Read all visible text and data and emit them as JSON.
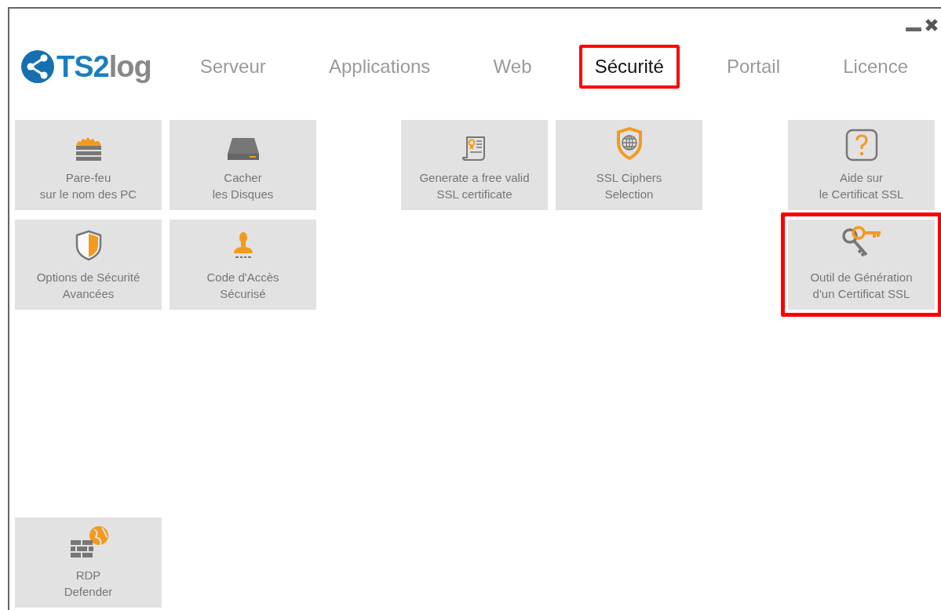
{
  "app": {
    "logo_prefix": "TS2",
    "logo_suffix": "log"
  },
  "tabs": [
    {
      "label": "Serveur",
      "selected": false
    },
    {
      "label": "Applications",
      "selected": false
    },
    {
      "label": "Web",
      "selected": false
    },
    {
      "label": "Sécurité",
      "selected": true
    },
    {
      "label": "Portail",
      "selected": false
    },
    {
      "label": "Licence",
      "selected": false
    }
  ],
  "tiles": [
    {
      "label": "Pare-feu\nsur le nom des PC",
      "highlighted": false
    },
    {
      "label": "Cacher\nles Disques",
      "highlighted": false
    },
    {
      "label": "Generate a free valid\nSSL certificate",
      "highlighted": false
    },
    {
      "label": "SSL Ciphers\nSelection",
      "highlighted": false
    },
    {
      "label": "Aide sur\nle Certificat SSL",
      "highlighted": false
    },
    {
      "label": "Options de Sécurité\nAvancées",
      "highlighted": false
    },
    {
      "label": "Code d'Accès\nSécurisé",
      "highlighted": false
    },
    {
      "label": "Outil de Génération\nd'un Certificat SSL",
      "highlighted": true
    },
    {
      "label": "RDP\nDefender",
      "highlighted": false
    }
  ]
}
